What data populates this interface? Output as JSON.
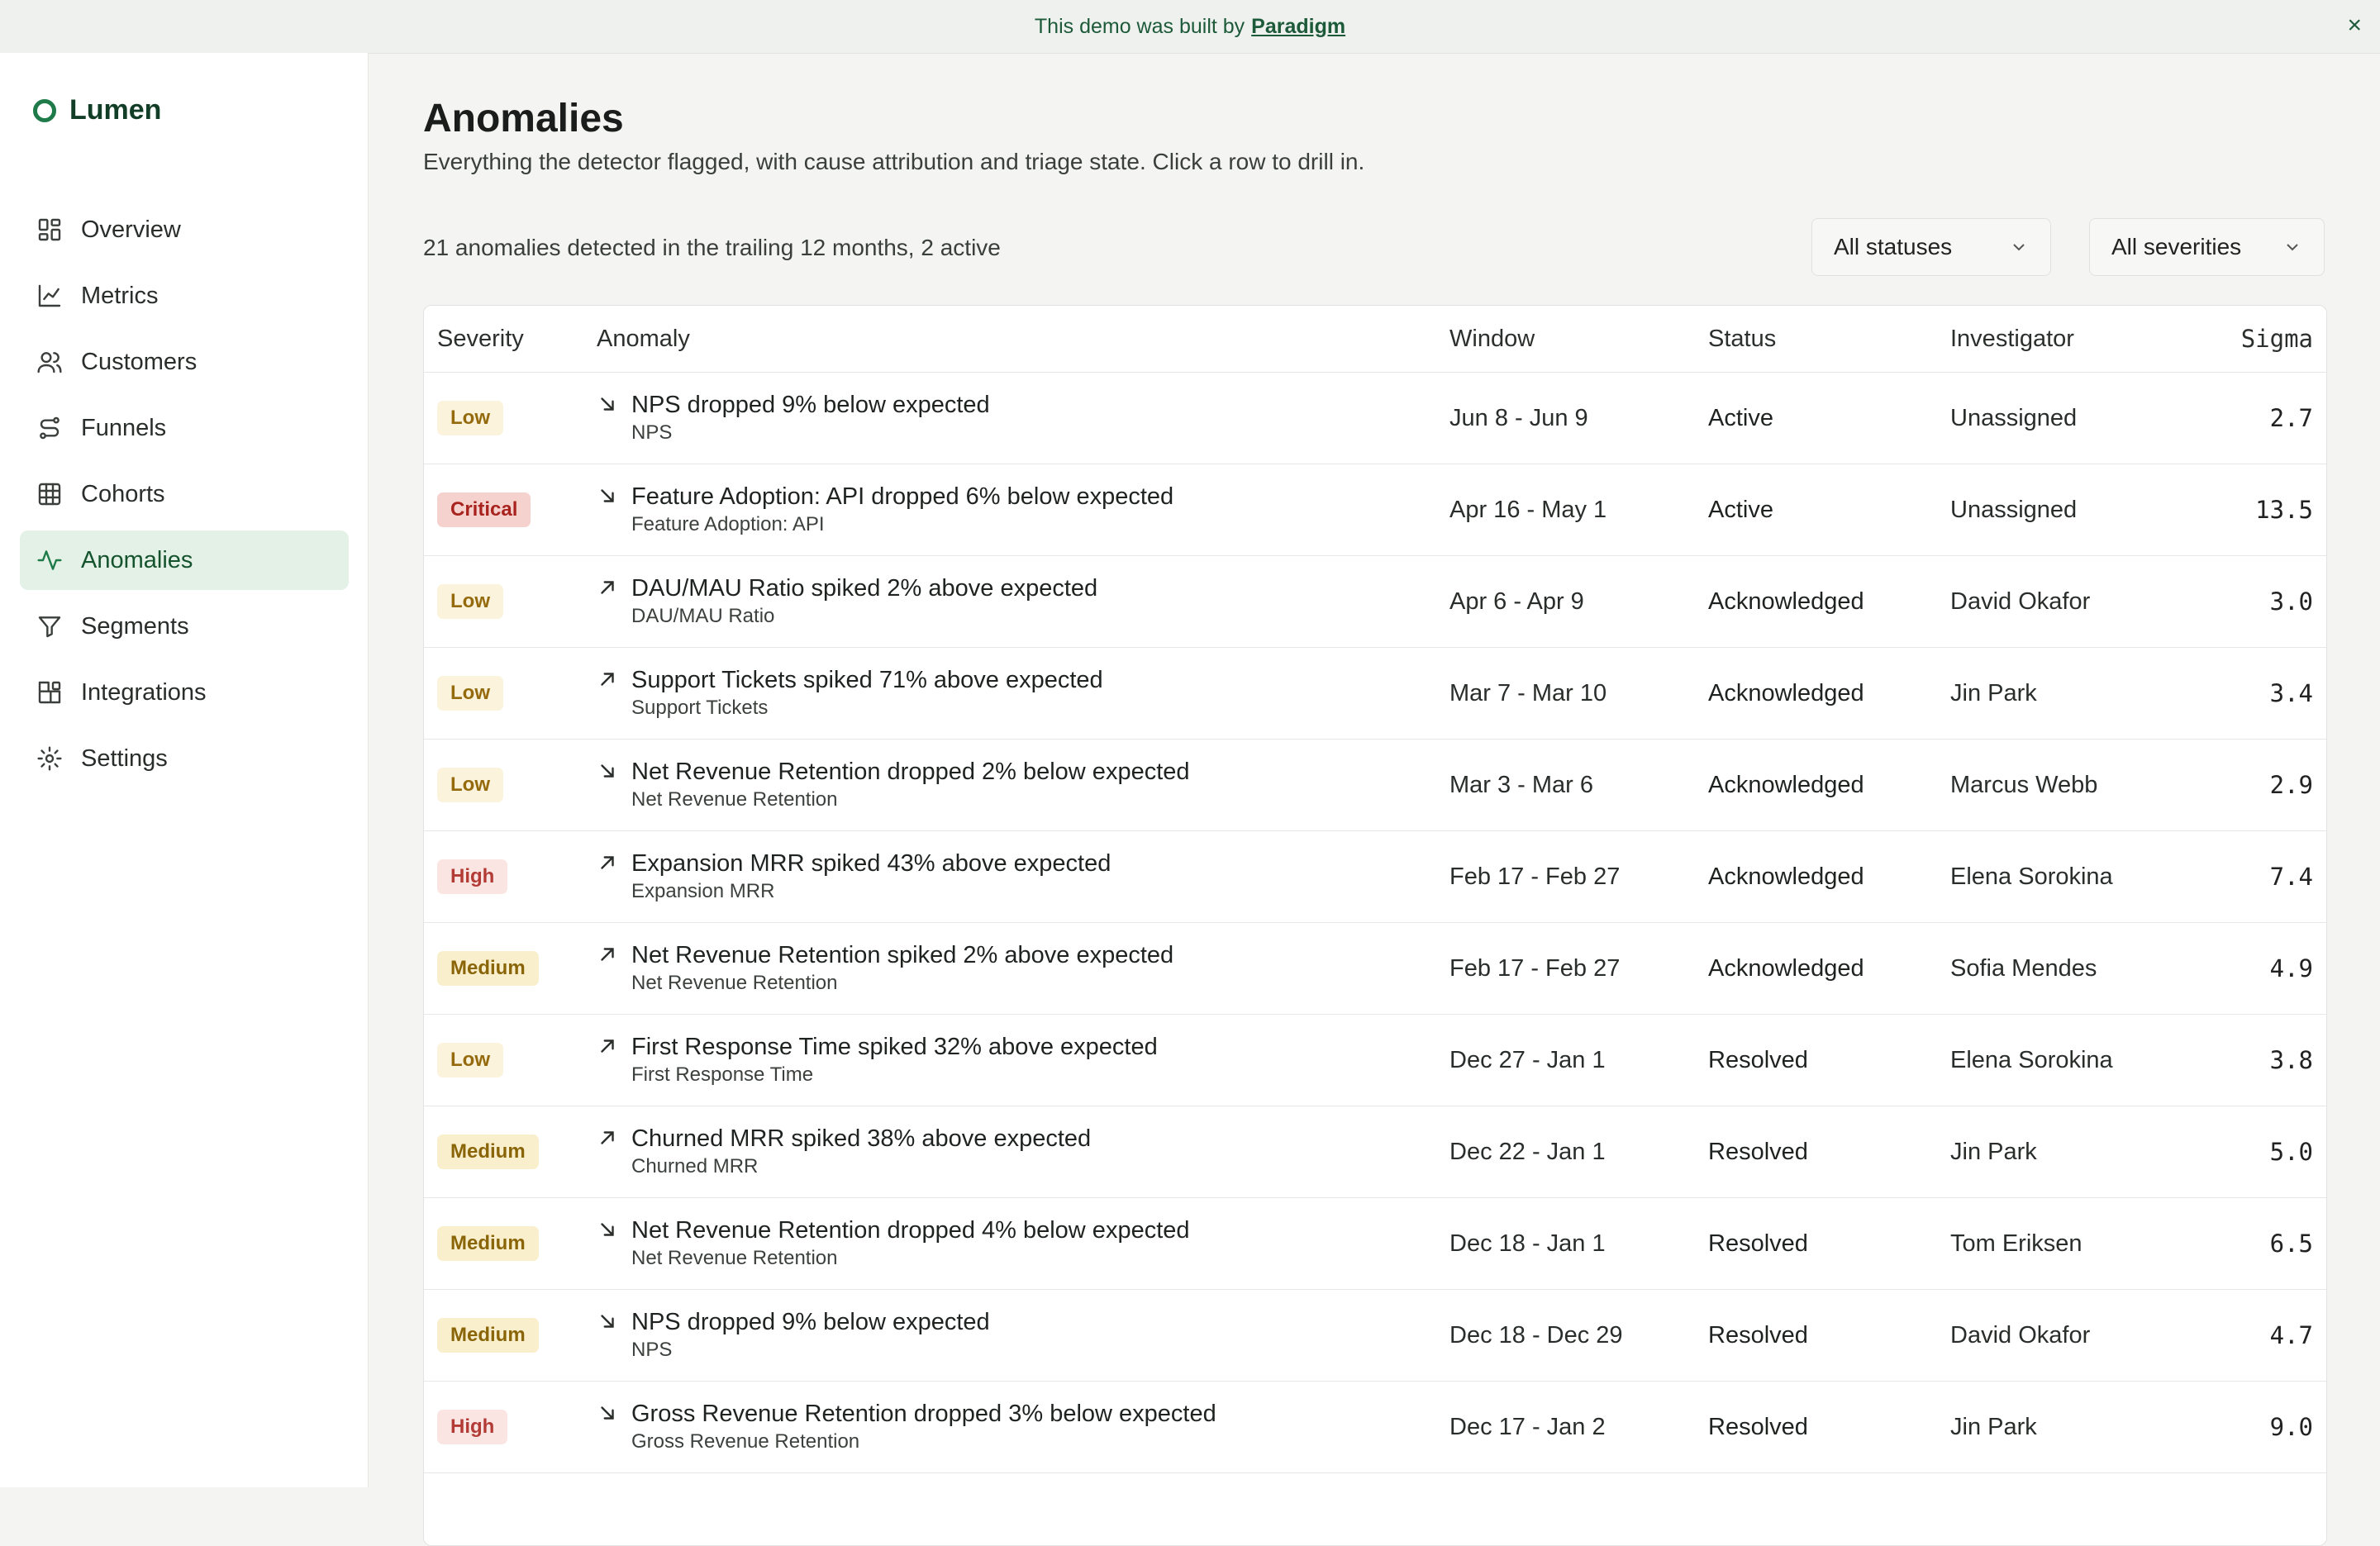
{
  "banner": {
    "text": "This demo was built by",
    "link": "Paradigm",
    "close": "×"
  },
  "app": {
    "name": "Lumen"
  },
  "sidebar": {
    "items": [
      {
        "label": "Overview",
        "icon": "grid-icon"
      },
      {
        "label": "Metrics",
        "icon": "line-chart-icon"
      },
      {
        "label": "Customers",
        "icon": "users-icon"
      },
      {
        "label": "Funnels",
        "icon": "route-icon"
      },
      {
        "label": "Cohorts",
        "icon": "table-icon"
      },
      {
        "label": "Anomalies",
        "icon": "activity-icon",
        "active": true
      },
      {
        "label": "Segments",
        "icon": "filter-icon"
      },
      {
        "label": "Integrations",
        "icon": "blocks-icon"
      },
      {
        "label": "Settings",
        "icon": "gear-icon"
      }
    ]
  },
  "page": {
    "title": "Anomalies",
    "subtitle": "Everything the detector flagged, with cause attribution and triage state. Click a row to drill in.",
    "summary": "21 anomalies detected in the trailing 12 months, 2 active"
  },
  "filters": {
    "status": "All statuses",
    "severity": "All severities"
  },
  "table": {
    "columns": [
      "Severity",
      "Anomaly",
      "Window",
      "Status",
      "Investigator",
      "Sigma"
    ],
    "rows": [
      {
        "severity": "Low",
        "direction": "down",
        "title": "NPS dropped 9% below expected",
        "metric": "NPS",
        "window": "Jun 8 - Jun 9",
        "status": "Active",
        "investigator": "Unassigned",
        "sigma": "2.7"
      },
      {
        "severity": "Critical",
        "direction": "down",
        "title": "Feature Adoption: API dropped 6% below expected",
        "metric": "Feature Adoption: API",
        "window": "Apr 16 - May 1",
        "status": "Active",
        "investigator": "Unassigned",
        "sigma": "13.5"
      },
      {
        "severity": "Low",
        "direction": "up",
        "title": "DAU/MAU Ratio spiked 2% above expected",
        "metric": "DAU/MAU Ratio",
        "window": "Apr 6 - Apr 9",
        "status": "Acknowledged",
        "investigator": "David Okafor",
        "sigma": "3.0"
      },
      {
        "severity": "Low",
        "direction": "up",
        "title": "Support Tickets spiked 71% above expected",
        "metric": "Support Tickets",
        "window": "Mar 7 - Mar 10",
        "status": "Acknowledged",
        "investigator": "Jin Park",
        "sigma": "3.4"
      },
      {
        "severity": "Low",
        "direction": "down",
        "title": "Net Revenue Retention dropped 2% below expected",
        "metric": "Net Revenue Retention",
        "window": "Mar 3 - Mar 6",
        "status": "Acknowledged",
        "investigator": "Marcus Webb",
        "sigma": "2.9"
      },
      {
        "severity": "High",
        "direction": "up",
        "title": "Expansion MRR spiked 43% above expected",
        "metric": "Expansion MRR",
        "window": "Feb 17 - Feb 27",
        "status": "Acknowledged",
        "investigator": "Elena Sorokina",
        "sigma": "7.4"
      },
      {
        "severity": "Medium",
        "direction": "up",
        "title": "Net Revenue Retention spiked 2% above expected",
        "metric": "Net Revenue Retention",
        "window": "Feb 17 - Feb 27",
        "status": "Acknowledged",
        "investigator": "Sofia Mendes",
        "sigma": "4.9"
      },
      {
        "severity": "Low",
        "direction": "up",
        "title": "First Response Time spiked 32% above expected",
        "metric": "First Response Time",
        "window": "Dec 27 - Jan 1",
        "status": "Resolved",
        "investigator": "Elena Sorokina",
        "sigma": "3.8"
      },
      {
        "severity": "Medium",
        "direction": "up",
        "title": "Churned MRR spiked 38% above expected",
        "metric": "Churned MRR",
        "window": "Dec 22 - Jan 1",
        "status": "Resolved",
        "investigator": "Jin Park",
        "sigma": "5.0"
      },
      {
        "severity": "Medium",
        "direction": "down",
        "title": "Net Revenue Retention dropped 4% below expected",
        "metric": "Net Revenue Retention",
        "window": "Dec 18 - Jan 1",
        "status": "Resolved",
        "investigator": "Tom Eriksen",
        "sigma": "6.5"
      },
      {
        "severity": "Medium",
        "direction": "down",
        "title": "NPS dropped 9% below expected",
        "metric": "NPS",
        "window": "Dec 18 - Dec 29",
        "status": "Resolved",
        "investigator": "David Okafor",
        "sigma": "4.7"
      },
      {
        "severity": "High",
        "direction": "down",
        "title": "Gross Revenue Retention dropped 3% below expected",
        "metric": "Gross Revenue Retention",
        "window": "Dec 17 - Jan 2",
        "status": "Resolved",
        "investigator": "Jin Park",
        "sigma": "9.0"
      }
    ]
  },
  "colors": {
    "accent": "#1f7a4a",
    "active_nav_bg": "#e3f1e6",
    "critical": "#a8231e",
    "high": "#b33b36",
    "medium": "#8a6508",
    "low": "#946a0c"
  }
}
